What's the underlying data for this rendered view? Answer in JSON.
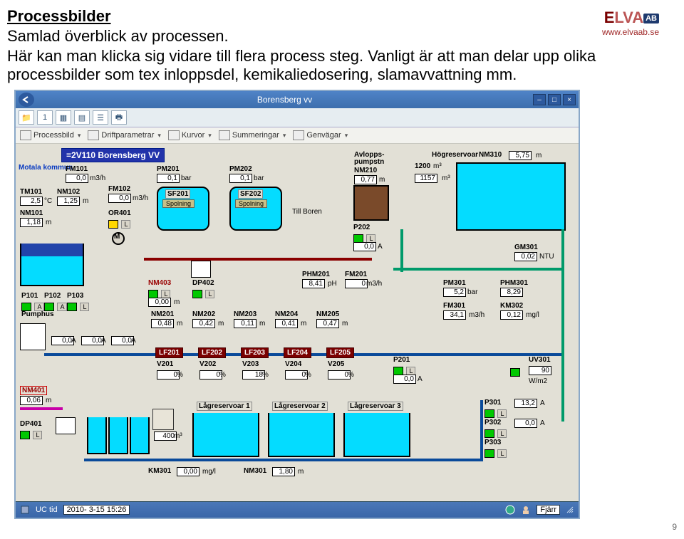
{
  "header": {
    "title": "Processbilder",
    "sub1": "Samlad överblick av processen.",
    "sub2": "Här kan man klicka sig vidare till flera process steg. Vanligt är att man delar upp olika processbilder som tex inloppsdel, kemikaliedosering, slamavvattning mm."
  },
  "logo": {
    "brand_e": "E",
    "brand_lva": "LVA",
    "brand_ab": "AB",
    "url": "www.elvaab.se"
  },
  "window": {
    "title": "Borensberg vv",
    "header_bar": "=2V110 Borensberg VV",
    "motala": "Motala kommun"
  },
  "menus": {
    "processbild": "Processbild",
    "driftparam": "Driftparametrar",
    "kurvor": "Kurvor",
    "summeringar": "Summeringar",
    "genvagar": "Genvägar"
  },
  "tags": {
    "FM101": {
      "label": "FM101",
      "val": "0,0",
      "unit": "m3/h"
    },
    "TM101": {
      "label": "TM101",
      "val": "2,5",
      "unit": "°C"
    },
    "NM102": {
      "label": "NM102",
      "val": "1,25",
      "unit": "m"
    },
    "NM101": {
      "label": "NM101",
      "val": "1,18",
      "unit": "m"
    },
    "FM102": {
      "label": "FM102",
      "val": "0,0",
      "unit": "m3/h"
    },
    "OR401": {
      "label": "OR401"
    },
    "PM201": {
      "label": "PM201",
      "val": "0,1",
      "unit": "bar"
    },
    "PM202": {
      "label": "PM202",
      "val": "0,1",
      "unit": "bar"
    },
    "SF201": {
      "label": "SF201",
      "btn": "Spolning"
    },
    "SF202": {
      "label": "SF202",
      "btn": "Spolning"
    },
    "TillBoren": {
      "label": "Till Boren"
    },
    "Avlopps": {
      "label1": "Avlopps-",
      "label2": "pumpstn",
      "tag": "NM210",
      "val": "0,77",
      "unit": "m"
    },
    "P202": {
      "label": "P202",
      "val": "0,0",
      "unit": "A"
    },
    "HogRes": {
      "label": "Högreservoar",
      "tag": "NM310",
      "val": "5,75",
      "unit": "m",
      "vol": "1200",
      "vol_unit": "m³",
      "val2": "1157",
      "val2_unit": "m³"
    },
    "GM301": {
      "label": "GM301",
      "val": "0,02",
      "unit": "NTU"
    },
    "Pumphus": {
      "label": "Pumphus"
    },
    "P101": {
      "label": "P101",
      "val": "0,0",
      "unit": "A"
    },
    "P102": {
      "label": "P102",
      "val": "0,0",
      "unit": "A"
    },
    "P103": {
      "label": "P103",
      "val": "0,0",
      "unit": "A"
    },
    "NM403": {
      "label": "NM403",
      "val": "0,00",
      "unit": "m"
    },
    "DP402": {
      "label": "DP402"
    },
    "NM201": {
      "label": "NM201",
      "val": "0,48",
      "unit": "m"
    },
    "NM202": {
      "label": "NM202",
      "val": "0,42",
      "unit": "m"
    },
    "NM203": {
      "label": "NM203",
      "val": "0,11",
      "unit": "m"
    },
    "NM204": {
      "label": "NM204",
      "val": "0,41",
      "unit": "m"
    },
    "NM205": {
      "label": "NM205",
      "val": "0,47",
      "unit": "m"
    },
    "PHM201": {
      "label": "PHM201",
      "val": "8,41",
      "unit": "pH"
    },
    "FM201": {
      "label": "FM201",
      "val": "0",
      "unit": "m3/h"
    },
    "PM301": {
      "label": "PM301",
      "val": "5,2",
      "unit": "bar"
    },
    "PHM301": {
      "label": "PHM301",
      "val": "8,29"
    },
    "FM301": {
      "label": "FM301",
      "val": "34,1",
      "unit": "m3/h"
    },
    "KM302": {
      "label": "KM302",
      "val": "0,12",
      "unit": "mg/l"
    },
    "LF201": {
      "label": "LF201"
    },
    "LF202": {
      "label": "LF202"
    },
    "LF203": {
      "label": "LF203"
    },
    "LF204": {
      "label": "LF204"
    },
    "LF205": {
      "label": "LF205"
    },
    "V201": {
      "label": "V201",
      "val": "0",
      "unit": "%"
    },
    "V202": {
      "label": "V202",
      "val": "0",
      "unit": "%"
    },
    "V203": {
      "label": "V203",
      "val": "18",
      "unit": "%"
    },
    "V204": {
      "label": "V204",
      "val": "0",
      "unit": "%"
    },
    "V205": {
      "label": "V205",
      "val": "0",
      "unit": "%"
    },
    "P201": {
      "label": "P201",
      "val": "0,0",
      "unit": "A"
    },
    "UV301": {
      "label": "UV301",
      "val": "90",
      "unit": "W/m2"
    },
    "NM401": {
      "label": "NM401",
      "val": "0,06",
      "unit": "m"
    },
    "DP401": {
      "label": "DP401"
    },
    "Lag1": {
      "label": "Lågreservoar 1"
    },
    "Lag2": {
      "label": "Lågreservoar 2"
    },
    "Lag3": {
      "label": "Lågreservoar 3"
    },
    "cube": {
      "val": "400",
      "unit": "m³"
    },
    "KM301": {
      "label": "KM301",
      "val": "0,00",
      "unit": "mg/l"
    },
    "NM301": {
      "label": "NM301",
      "val": "1,80",
      "unit": "m"
    },
    "P301": {
      "label": "P301",
      "val": "13,2",
      "unit": "A"
    },
    "P302": {
      "label": "P302",
      "val": "0,0",
      "unit": "A"
    },
    "P303": {
      "label": "P303"
    }
  },
  "statusbar": {
    "uctid_label": "UC tid",
    "uctid": "2010- 3-15  15:26",
    "fjarr": "Fjärr"
  },
  "page_number": "9"
}
